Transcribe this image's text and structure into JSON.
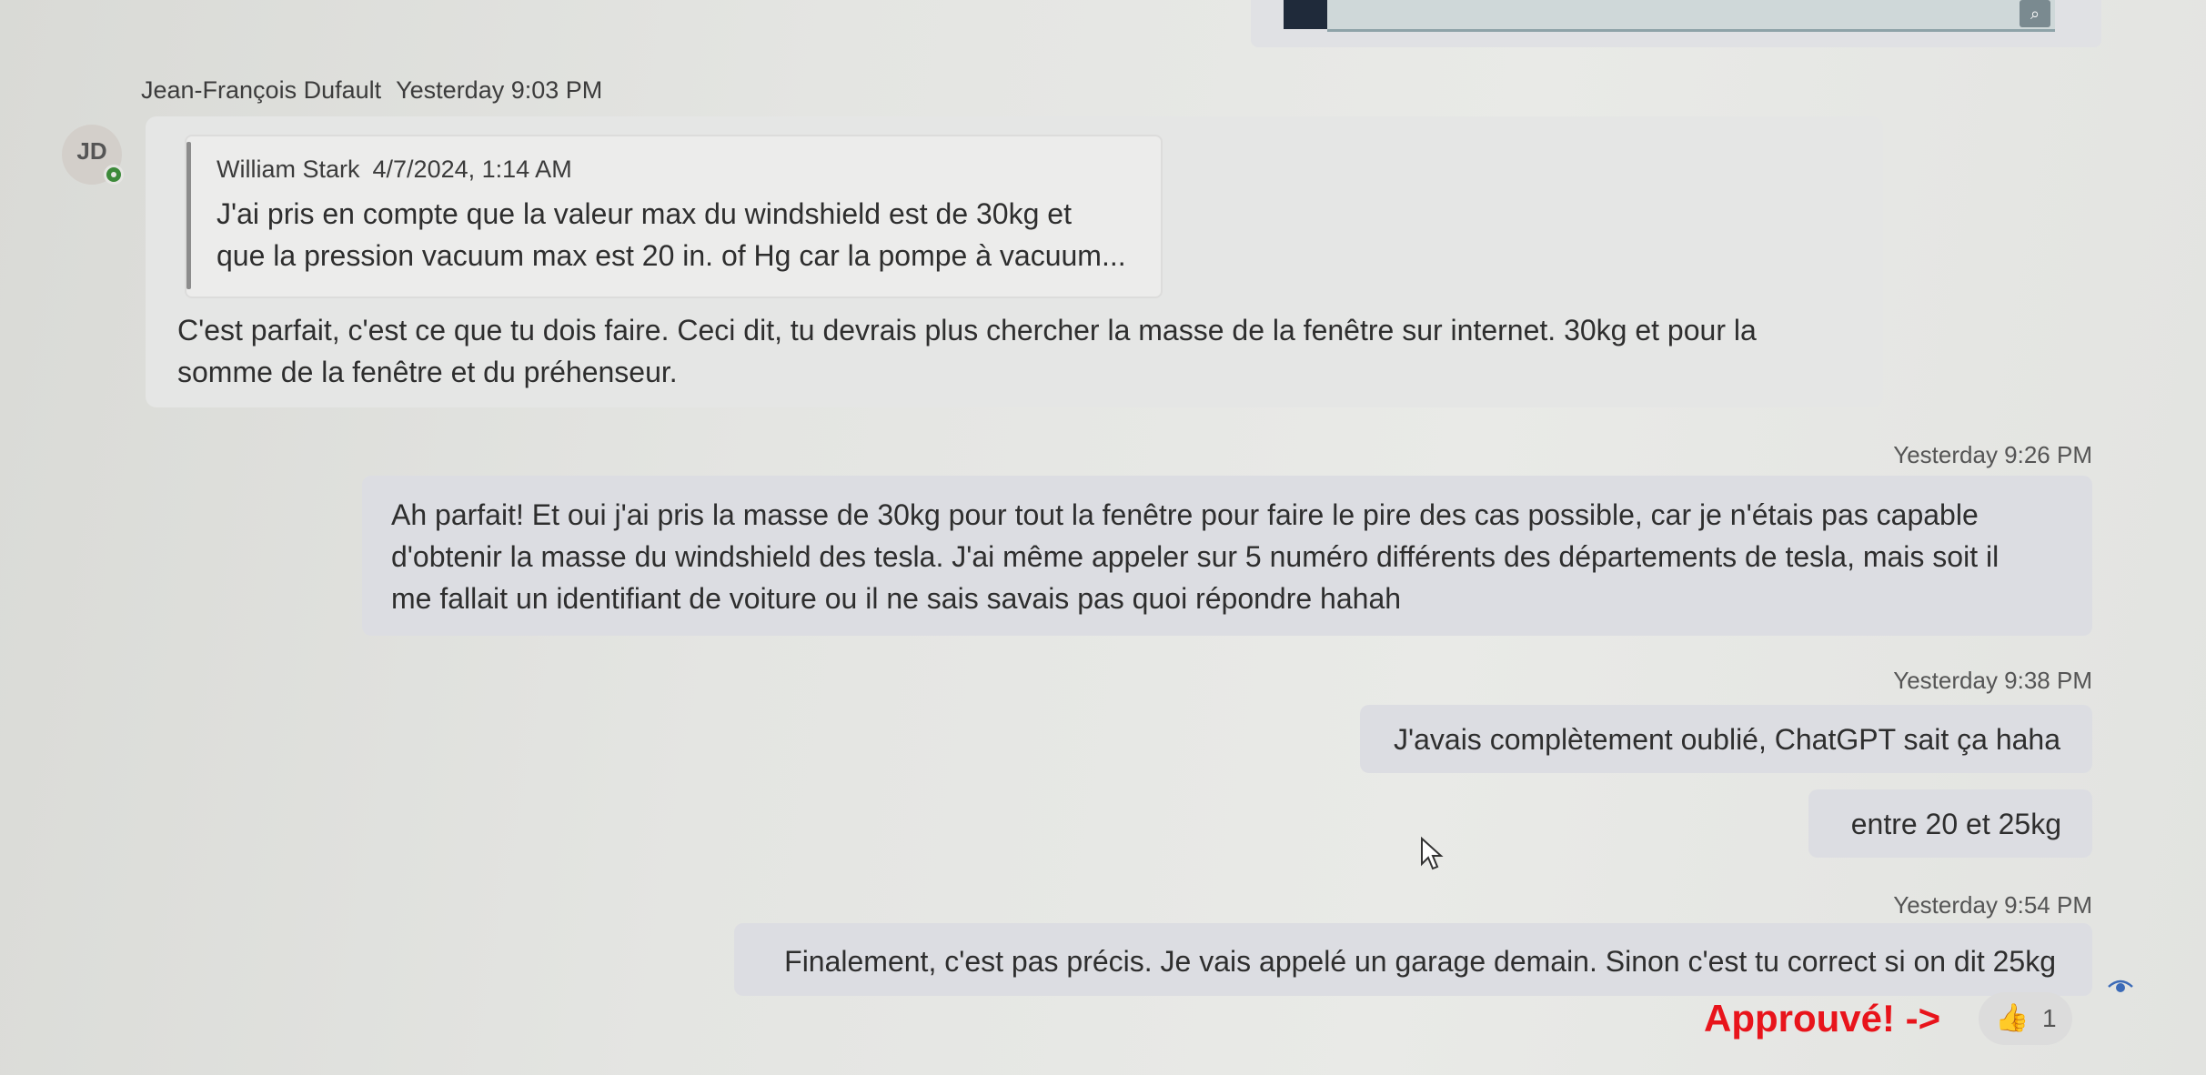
{
  "top_attachment": {
    "zoom_icon": "zoom-in-icon"
  },
  "thread": {
    "incoming_message": {
      "sender": "Jean-François Dufault",
      "time": "Yesterday 9:03 PM",
      "avatar_initials": "JD",
      "presence": "available",
      "quote": {
        "author": "William Stark",
        "time": "4/7/2024, 1:14 AM",
        "line1": "J'ai pris en compte que la valeur max du windshield est de 30kg et",
        "line2": "que la pression vacuum max est 20 in. of Hg car la pompe à vacuum..."
      },
      "text_line1": "C'est parfait, c'est ce que tu dois faire. Ceci dit, tu devrais plus chercher la masse de la fenêtre sur internet. 30kg et pour la",
      "text_line2": "somme de la fenêtre et du préhenseur."
    },
    "outgoing_groups": [
      {
        "time": "Yesterday 9:26 PM",
        "messages": [
          {
            "line1": "Ah parfait! Et oui j'ai pris la masse de 30kg pour tout la fenêtre pour faire le pire des cas possible, car je n'étais pas capable",
            "line2": "d'obtenir la masse du windshield des tesla. J'ai même appeler sur 5 numéro différents des départements de tesla, mais soit il",
            "line3": "me fallait un identifiant de voiture ou il ne sais savais pas quoi répondre hahah"
          }
        ]
      },
      {
        "time": "Yesterday 9:38 PM",
        "messages": [
          {
            "text": "J'avais complètement oublié, ChatGPT sait ça haha"
          },
          {
            "text": "entre 20 et 25kg"
          }
        ]
      },
      {
        "time": "Yesterday 9:54 PM",
        "messages": [
          {
            "text": "Finalement, c'est pas précis. Je vais appelé un garage demain. Sinon c'est tu correct si on dit 25kg"
          }
        ]
      }
    ],
    "annotation": "Approuvé! ->",
    "reaction": {
      "emoji": "👍",
      "count": "1",
      "icon": "thumbs-up-icon"
    },
    "seen_indicator": "eye-icon"
  },
  "colors": {
    "annotation": "#e8141b",
    "presence": "#3d8a3a",
    "outgoing_bubble": "#dcdde2"
  }
}
